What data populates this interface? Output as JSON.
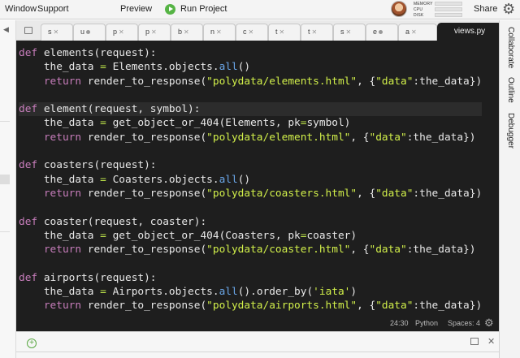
{
  "menu": {
    "window": "Window",
    "support": "Support",
    "preview": "Preview",
    "run_project": "Run Project",
    "share": "Share"
  },
  "stats": {
    "memory": "MEMORY",
    "cpu": "CPU",
    "disk": "DISK"
  },
  "tabs": [
    "s",
    "u",
    "p",
    "p",
    "b",
    "n",
    "c",
    "t",
    "t",
    "s",
    "e",
    "a"
  ],
  "active_tab": "views.py",
  "right_panel": [
    "Collaborate",
    "Outline",
    "Debugger"
  ],
  "status": {
    "position": "24:30",
    "language": "Python",
    "spaces": "Spaces: 4"
  },
  "icons": {
    "run": "run-icon",
    "gear": "gear-icon",
    "add": "add-icon",
    "popout": "popout-icon",
    "close": "close-icon"
  },
  "colors": {
    "editor_bg": "#1e1e1e",
    "keyword": "#c77dbb",
    "string": "#d2f04a",
    "builtin": "#6aa6e8",
    "run_green": "#56b445"
  },
  "code_lines": [
    "def elements(request):",
    "    the_data = Elements.objects.all()",
    "    return render_to_response(\"polydata/elements.html\", {\"data\":the_data})",
    "",
    "def element(request, symbol):",
    "    the_data = get_object_or_404(Elements, pk=symbol)",
    "    return render_to_response(\"polydata/element.html\", {\"data\":the_data})",
    "",
    "def coasters(request):",
    "    the_data = Coasters.objects.all()",
    "    return render_to_response(\"polydata/coasters.html\", {\"data\":the_data})",
    "",
    "def coaster(request, coaster):",
    "    the_data = get_object_or_404(Coasters, pk=coaster)",
    "    return render_to_response(\"polydata/coaster.html\", {\"data\":the_data})",
    "",
    "def airports(request):",
    "    the_data = Airports.objects.all().order_by('iata')",
    "    return render_to_response(\"polydata/airports.html\", {\"data\":the_data})"
  ]
}
